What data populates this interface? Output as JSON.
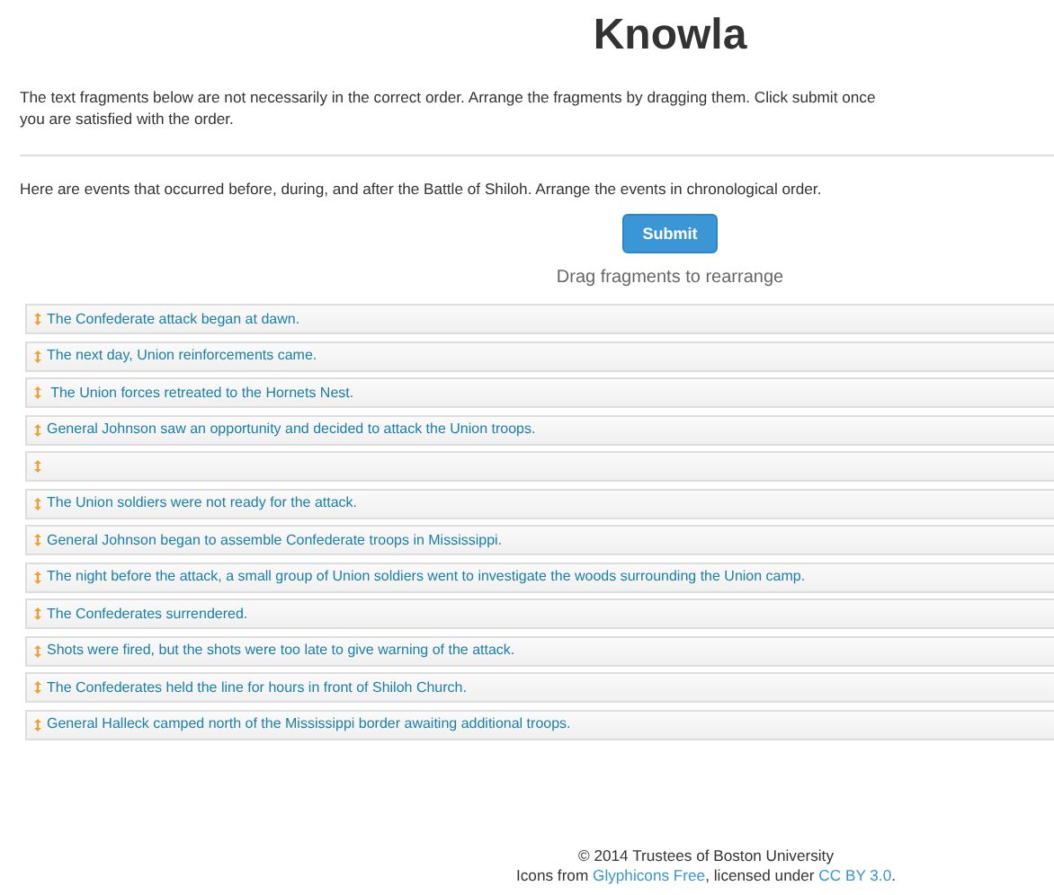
{
  "title": "Knowla",
  "instructions": "The text fragments below are not necessarily in the correct order. Arrange the fragments by dragging them. Click submit once you are satisfied with the order.",
  "prompt": "Here are events that occurred before, during, and after the Battle of Shiloh. Arrange the events in chronological order.",
  "submit_button": "Submit",
  "hint": "Drag fragments to rearrange",
  "fragments": [
    {
      "text": "The Confederate attack began at dawn."
    },
    {
      "text": "The next day, Union reinforcements came."
    },
    {
      "text": " The Union forces retreated to the Hornets Nest."
    },
    {
      "text": "General Johnson saw an opportunity and decided to attack the Union troops."
    },
    {
      "kind": "blank"
    },
    {
      "text": "The Union soldiers were not ready for the attack."
    },
    {
      "text": "General Johnson began to assemble Confederate troops in Mississippi."
    },
    {
      "text": "The night before the attack, a small group of Union soldiers went to investigate the woods surrounding the Union camp."
    },
    {
      "text": "The Confederates surrendered."
    },
    {
      "text": "Shots were fired, but the shots were too late to give warning of the attack."
    },
    {
      "text": "The Confederates held the line for hours in front of Shiloh Church."
    },
    {
      "text": "General Halleck camped north of the Mississippi border awaiting additional troops."
    }
  ],
  "footer": {
    "copyright": "© 2014 Trustees of Boston University",
    "credit": [
      {
        "kind": "text",
        "text": "Icons from "
      },
      {
        "kind": "link",
        "text": "Glyphicons Free"
      },
      {
        "kind": "text",
        "text": ", licensed under "
      },
      {
        "kind": "link",
        "text": "CC BY 3.0"
      },
      {
        "kind": "text",
        "text": "."
      }
    ]
  }
}
